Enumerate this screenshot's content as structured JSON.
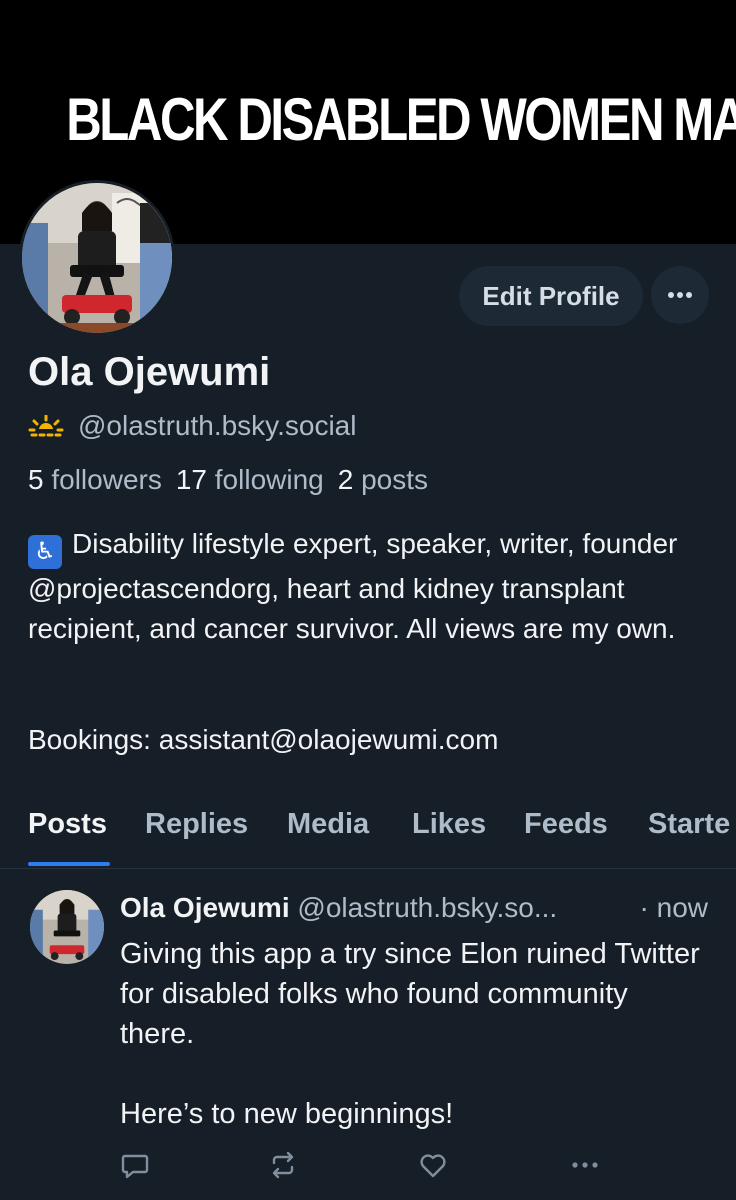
{
  "banner": {
    "text": "BLACK DISABLED WOMEN MATTER"
  },
  "profile": {
    "display_name": "Ola Ojewumi",
    "handle": "@olastruth.bsky.social",
    "handle_badge": "sun-icon",
    "followers_count": "5",
    "followers_label": "followers",
    "following_count": "17",
    "following_label": "following",
    "posts_count": "2",
    "posts_label": "posts",
    "bio_text": "Disability lifestyle expert, speaker, writer, founder @projectascendorg, heart and kidney transplant recipient, and cancer survivor. All views are my own.",
    "bio_emoji": "♿",
    "bookings": "Bookings: assistant@olaojewumi.com"
  },
  "actions": {
    "edit_profile": "Edit Profile",
    "more": "···"
  },
  "tabs": [
    "Posts",
    "Replies",
    "Media",
    "Likes",
    "Feeds",
    "Starte"
  ],
  "active_tab": "Posts",
  "post": {
    "author": "Ola Ojewumi",
    "handle": "@olastruth.bsky.so...",
    "time": "· now",
    "body_1": "Giving this app a try since Elon ruined Twitter for disabled folks who found community there.",
    "body_2": "Here’s to new beginnings!",
    "icons": [
      "reply-icon",
      "repost-icon",
      "like-icon",
      "more-icon"
    ],
    "more_label": "···"
  },
  "colors": {
    "background": "#161e27",
    "banner": "#000000",
    "accent": "#2f7bf0",
    "muted_text": "#aebbc9",
    "button_bg": "#1e2936"
  }
}
